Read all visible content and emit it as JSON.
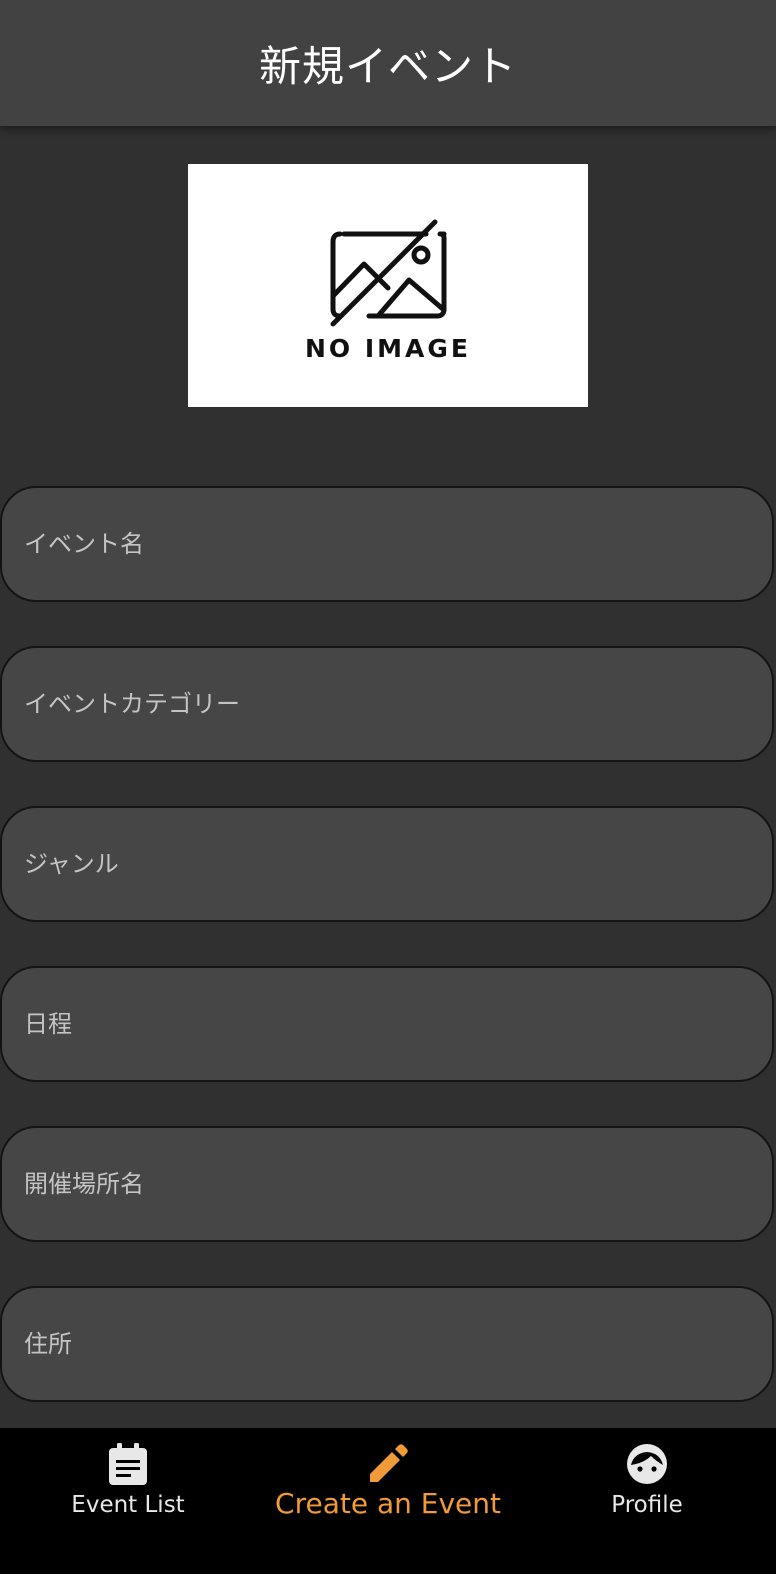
{
  "header": {
    "title": "新規イベント"
  },
  "image_placeholder": {
    "label": "NO IMAGE",
    "icon": "no-image-icon"
  },
  "form": {
    "fields": [
      {
        "placeholder": "イベント名",
        "value": ""
      },
      {
        "placeholder": "イベントカテゴリー",
        "value": ""
      },
      {
        "placeholder": "ジャンル",
        "value": ""
      },
      {
        "placeholder": "日程",
        "value": ""
      },
      {
        "placeholder": "開催場所名",
        "value": ""
      },
      {
        "placeholder": "住所",
        "value": ""
      }
    ]
  },
  "bottom_nav": {
    "items": [
      {
        "label": "Event List",
        "icon": "event-list-icon",
        "active": false
      },
      {
        "label": "Create an Event",
        "icon": "pencil-icon",
        "active": true
      },
      {
        "label": "Profile",
        "icon": "face-icon",
        "active": false
      }
    ]
  },
  "colors": {
    "background": "#303030",
    "app_bar": "#424242",
    "field_fill": "#464646",
    "nav_background": "#000000",
    "accent": "#f19a38"
  }
}
